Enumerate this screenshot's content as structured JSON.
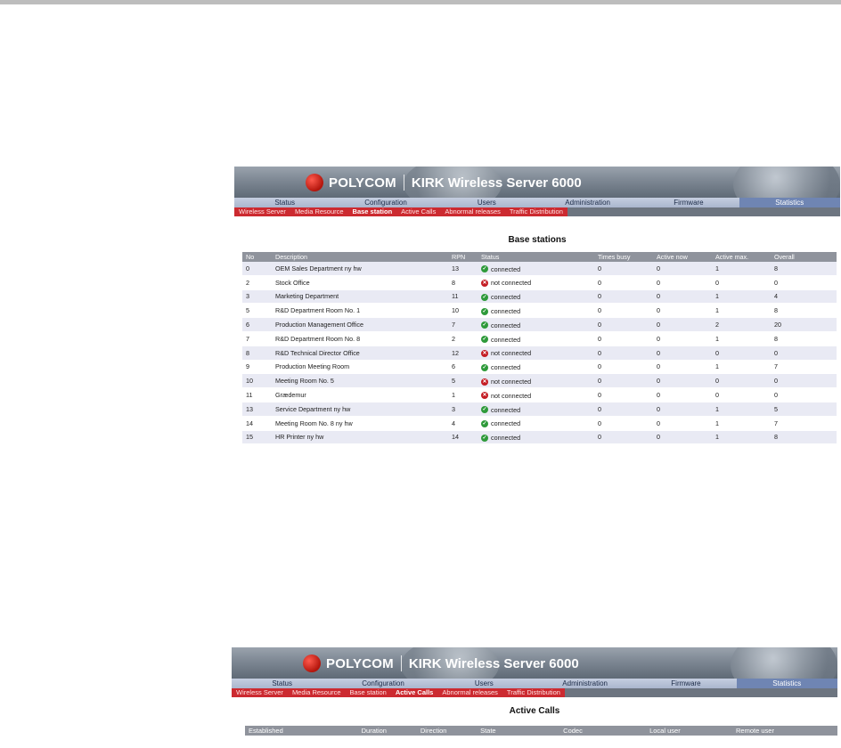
{
  "brand": {
    "logo_text": "POLYCOM",
    "product": "KIRK Wireless Server 6000"
  },
  "main_nav": [
    "Status",
    "Configuration",
    "Users",
    "Administration",
    "Firmware",
    "Statistics"
  ],
  "sub_nav": [
    "Wireless Server",
    "Media Resource",
    "Base station",
    "Active Calls",
    "Abnormal releases",
    "Traffic Distribution"
  ],
  "panel1": {
    "active_main": "Statistics",
    "active_sub": "Base station",
    "title": "Base stations",
    "columns": [
      "No",
      "Description",
      "RPN",
      "Status",
      "Times busy",
      "Active now",
      "Active max.",
      "Overall"
    ],
    "rows": [
      {
        "no": "0",
        "description": "OEM Sales Department ny hw",
        "rpn": "13",
        "status": "connected",
        "ok": true,
        "times_busy": "0",
        "active_now": "0",
        "active_max": "1",
        "overall": "8"
      },
      {
        "no": "2",
        "description": "Stock Office",
        "rpn": "8",
        "status": "not connected",
        "ok": false,
        "times_busy": "0",
        "active_now": "0",
        "active_max": "0",
        "overall": "0"
      },
      {
        "no": "3",
        "description": "Marketing Department",
        "rpn": "11",
        "status": "connected",
        "ok": true,
        "times_busy": "0",
        "active_now": "0",
        "active_max": "1",
        "overall": "4"
      },
      {
        "no": "5",
        "description": "R&D Department Room No. 1",
        "rpn": "10",
        "status": "connected",
        "ok": true,
        "times_busy": "0",
        "active_now": "0",
        "active_max": "1",
        "overall": "8"
      },
      {
        "no": "6",
        "description": "Production Management Office",
        "rpn": "7",
        "status": "connected",
        "ok": true,
        "times_busy": "0",
        "active_now": "0",
        "active_max": "2",
        "overall": "20"
      },
      {
        "no": "7",
        "description": "R&D Department Room No. 8",
        "rpn": "2",
        "status": "connected",
        "ok": true,
        "times_busy": "0",
        "active_now": "0",
        "active_max": "1",
        "overall": "8"
      },
      {
        "no": "8",
        "description": "R&D Technical Director Office",
        "rpn": "12",
        "status": "not connected",
        "ok": false,
        "times_busy": "0",
        "active_now": "0",
        "active_max": "0",
        "overall": "0"
      },
      {
        "no": "9",
        "description": "Production Meeting Room",
        "rpn": "6",
        "status": "connected",
        "ok": true,
        "times_busy": "0",
        "active_now": "0",
        "active_max": "1",
        "overall": "7"
      },
      {
        "no": "10",
        "description": "Meeting Room No. 5",
        "rpn": "5",
        "status": "not connected",
        "ok": false,
        "times_busy": "0",
        "active_now": "0",
        "active_max": "0",
        "overall": "0"
      },
      {
        "no": "11",
        "description": "Grædemur",
        "rpn": "1",
        "status": "not connected",
        "ok": false,
        "times_busy": "0",
        "active_now": "0",
        "active_max": "0",
        "overall": "0"
      },
      {
        "no": "13",
        "description": "Service Department ny hw",
        "rpn": "3",
        "status": "connected",
        "ok": true,
        "times_busy": "0",
        "active_now": "0",
        "active_max": "1",
        "overall": "5"
      },
      {
        "no": "14",
        "description": "Meeting Room No. 8 ny hw",
        "rpn": "4",
        "status": "connected",
        "ok": true,
        "times_busy": "0",
        "active_now": "0",
        "active_max": "1",
        "overall": "7"
      },
      {
        "no": "15",
        "description": "HR Printer ny hw",
        "rpn": "14",
        "status": "connected",
        "ok": true,
        "times_busy": "0",
        "active_now": "0",
        "active_max": "1",
        "overall": "8"
      }
    ]
  },
  "panel2": {
    "active_main": "Statistics",
    "active_sub": "Active Calls",
    "title": "Active Calls",
    "columns": [
      "Established",
      "Duration",
      "Direction",
      "State",
      "Codec",
      "Local user",
      "Remote user"
    ]
  },
  "colors": {
    "status_ok": "#2e9a3a",
    "status_bad": "#c41d24",
    "subnav_red": "#cc2a30",
    "nav_active": "#6f85b3"
  },
  "icons": {
    "connected": "check-circle-icon",
    "not_connected": "x-circle-icon",
    "logo": "polycom-logo-icon"
  }
}
